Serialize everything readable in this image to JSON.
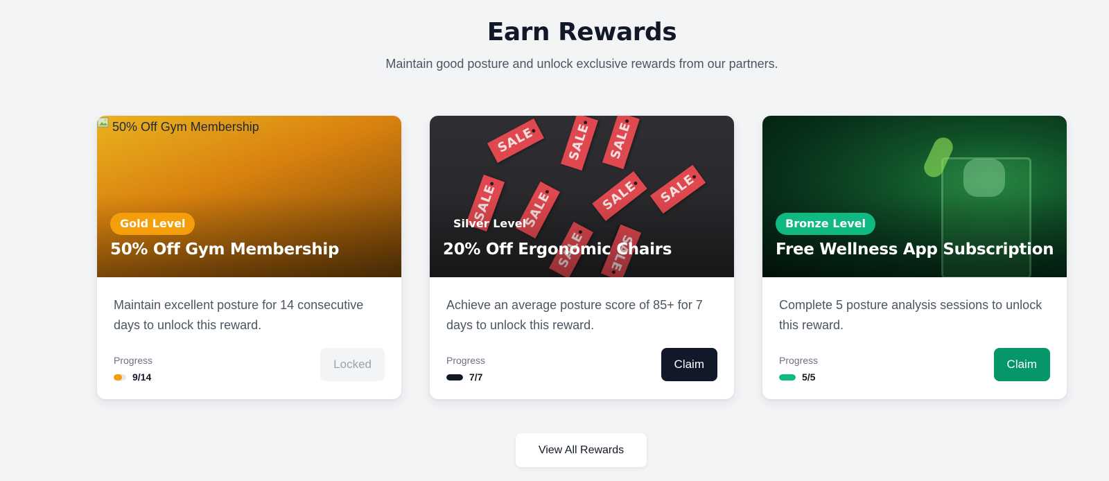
{
  "header": {
    "title": "Earn Rewards",
    "subtitle": "Maintain good posture and unlock exclusive rewards from our partners."
  },
  "cards": [
    {
      "image_alt": "50% Off Gym Membership",
      "level": "Gold Level",
      "title": "50% Off Gym Membership",
      "description": "Maintain excellent posture for 14 consecutive days to unlock this reward.",
      "progress_label": "Progress",
      "progress_text": "9/14",
      "progress_fraction": 0.643,
      "progress_color": "#f59e0b",
      "button_label": "Locked",
      "button_state": "locked"
    },
    {
      "level": "Silver Level",
      "title": "20% Off Ergonomic Chairs",
      "description": "Achieve an average posture score of 85+ for 7 days to unlock this reward.",
      "progress_label": "Progress",
      "progress_text": "7/7",
      "progress_fraction": 1.0,
      "progress_color": "#111827",
      "button_label": "Claim",
      "button_state": "claimable",
      "image_tag_text": "SALE"
    },
    {
      "level": "Bronze Level",
      "title": "Free Wellness App Subscription",
      "description": "Complete 5 posture analysis sessions to unlock this reward.",
      "progress_label": "Progress",
      "progress_text": "5/5",
      "progress_fraction": 1.0,
      "progress_color": "#10b981",
      "button_label": "Claim",
      "button_state": "claimable"
    }
  ],
  "view_all_label": "View All Rewards",
  "colors": {
    "gold": "#f59e0b",
    "bronze": "#10b981",
    "claim_dark": "#111827",
    "claim_green": "#059669",
    "background": "#f3f4f6"
  }
}
